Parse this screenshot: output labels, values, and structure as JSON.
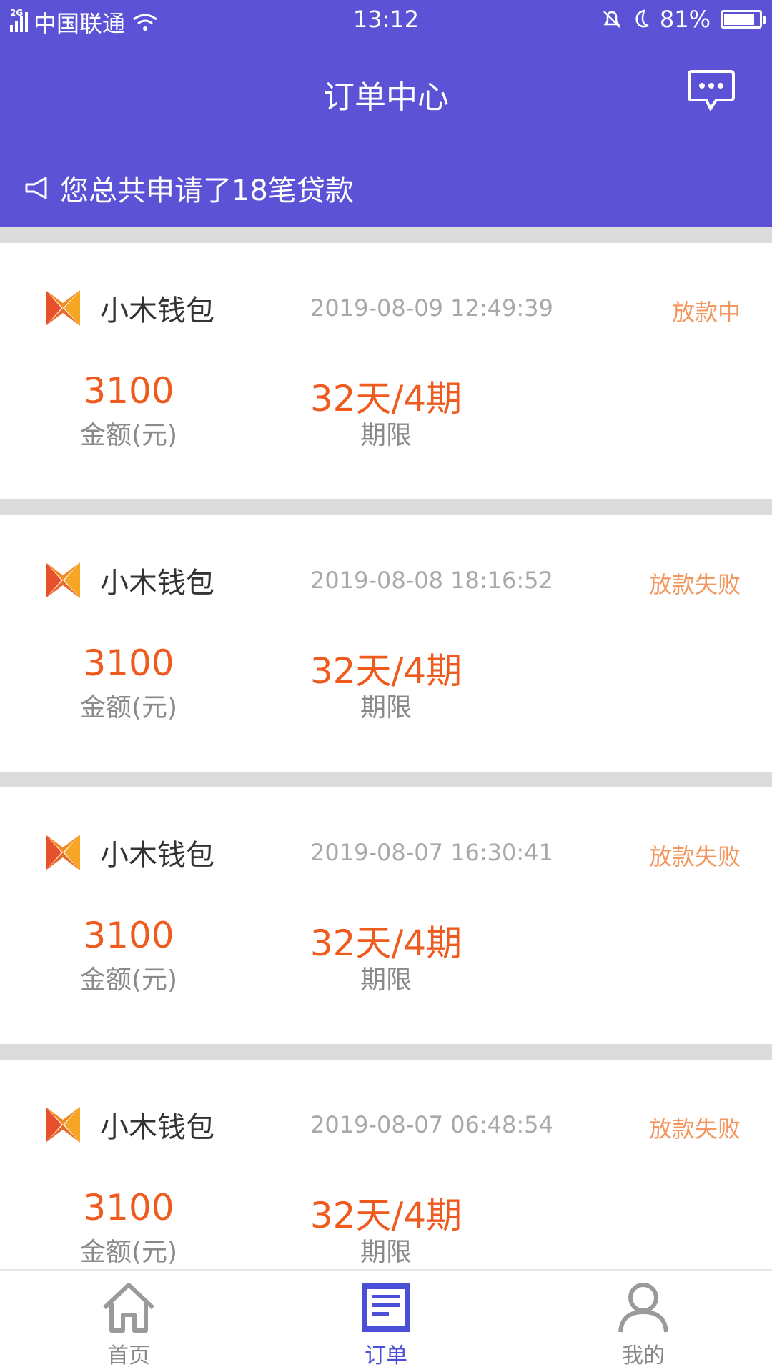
{
  "status_bar": {
    "network_tag": "2G",
    "carrier": "中国联通",
    "time": "13:12",
    "battery": "81%"
  },
  "header": {
    "title": "订单中心",
    "message_icon": "chat-bubble-icon"
  },
  "notice": {
    "icon": "megaphone-icon",
    "text": "您总共申请了18笔贷款"
  },
  "orders": [
    {
      "brand": "小木钱包",
      "datetime": "2019-08-09 12:49:39",
      "status": "放款中",
      "amount": "3100",
      "amount_label": "金额(元)",
      "term": "32天/4期",
      "term_label": "期限"
    },
    {
      "brand": "小木钱包",
      "datetime": "2019-08-08 18:16:52",
      "status": "放款失败",
      "amount": "3100",
      "amount_label": "金额(元)",
      "term": "32天/4期",
      "term_label": "期限"
    },
    {
      "brand": "小木钱包",
      "datetime": "2019-08-07 16:30:41",
      "status": "放款失败",
      "amount": "3100",
      "amount_label": "金额(元)",
      "term": "32天/4期",
      "term_label": "期限"
    },
    {
      "brand": "小木钱包",
      "datetime": "2019-08-07 06:48:54",
      "status": "放款失败",
      "amount": "3100",
      "amount_label": "金额(元)",
      "term": "32天/4期",
      "term_label": "期限"
    }
  ],
  "bottom_nav": {
    "items": [
      {
        "label": "首页",
        "icon": "home-icon"
      },
      {
        "label": "订单",
        "icon": "order-icon",
        "active": true
      },
      {
        "label": "我的",
        "icon": "user-icon"
      }
    ]
  },
  "colors": {
    "header_bg": "#5b52d6",
    "amount_orange": "#ef5a1e",
    "status_orange": "#f4975f",
    "nav_active": "#4b4fd8"
  }
}
